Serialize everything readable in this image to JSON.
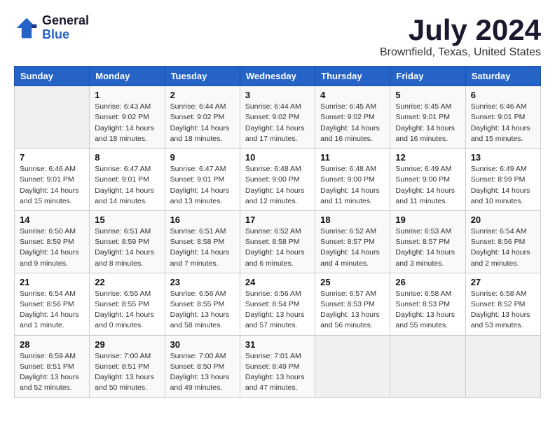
{
  "logo": {
    "general": "General",
    "blue": "Blue"
  },
  "title": "July 2024",
  "subtitle": "Brownfield, Texas, United States",
  "days_of_week": [
    "Sunday",
    "Monday",
    "Tuesday",
    "Wednesday",
    "Thursday",
    "Friday",
    "Saturday"
  ],
  "weeks": [
    [
      {
        "day": "",
        "info": ""
      },
      {
        "day": "1",
        "info": "Sunrise: 6:43 AM\nSunset: 9:02 PM\nDaylight: 14 hours\nand 18 minutes."
      },
      {
        "day": "2",
        "info": "Sunrise: 6:44 AM\nSunset: 9:02 PM\nDaylight: 14 hours\nand 18 minutes."
      },
      {
        "day": "3",
        "info": "Sunrise: 6:44 AM\nSunset: 9:02 PM\nDaylight: 14 hours\nand 17 minutes."
      },
      {
        "day": "4",
        "info": "Sunrise: 6:45 AM\nSunset: 9:02 PM\nDaylight: 14 hours\nand 16 minutes."
      },
      {
        "day": "5",
        "info": "Sunrise: 6:45 AM\nSunset: 9:01 PM\nDaylight: 14 hours\nand 16 minutes."
      },
      {
        "day": "6",
        "info": "Sunrise: 6:46 AM\nSunset: 9:01 PM\nDaylight: 14 hours\nand 15 minutes."
      }
    ],
    [
      {
        "day": "7",
        "info": "Sunrise: 6:46 AM\nSunset: 9:01 PM\nDaylight: 14 hours\nand 15 minutes."
      },
      {
        "day": "8",
        "info": "Sunrise: 6:47 AM\nSunset: 9:01 PM\nDaylight: 14 hours\nand 14 minutes."
      },
      {
        "day": "9",
        "info": "Sunrise: 6:47 AM\nSunset: 9:01 PM\nDaylight: 14 hours\nand 13 minutes."
      },
      {
        "day": "10",
        "info": "Sunrise: 6:48 AM\nSunset: 9:00 PM\nDaylight: 14 hours\nand 12 minutes."
      },
      {
        "day": "11",
        "info": "Sunrise: 6:48 AM\nSunset: 9:00 PM\nDaylight: 14 hours\nand 11 minutes."
      },
      {
        "day": "12",
        "info": "Sunrise: 6:49 AM\nSunset: 9:00 PM\nDaylight: 14 hours\nand 11 minutes."
      },
      {
        "day": "13",
        "info": "Sunrise: 6:49 AM\nSunset: 8:59 PM\nDaylight: 14 hours\nand 10 minutes."
      }
    ],
    [
      {
        "day": "14",
        "info": "Sunrise: 6:50 AM\nSunset: 8:59 PM\nDaylight: 14 hours\nand 9 minutes."
      },
      {
        "day": "15",
        "info": "Sunrise: 6:51 AM\nSunset: 8:59 PM\nDaylight: 14 hours\nand 8 minutes."
      },
      {
        "day": "16",
        "info": "Sunrise: 6:51 AM\nSunset: 8:58 PM\nDaylight: 14 hours\nand 7 minutes."
      },
      {
        "day": "17",
        "info": "Sunrise: 6:52 AM\nSunset: 8:58 PM\nDaylight: 14 hours\nand 6 minutes."
      },
      {
        "day": "18",
        "info": "Sunrise: 6:52 AM\nSunset: 8:57 PM\nDaylight: 14 hours\nand 4 minutes."
      },
      {
        "day": "19",
        "info": "Sunrise: 6:53 AM\nSunset: 8:57 PM\nDaylight: 14 hours\nand 3 minutes."
      },
      {
        "day": "20",
        "info": "Sunrise: 6:54 AM\nSunset: 8:56 PM\nDaylight: 14 hours\nand 2 minutes."
      }
    ],
    [
      {
        "day": "21",
        "info": "Sunrise: 6:54 AM\nSunset: 8:56 PM\nDaylight: 14 hours\nand 1 minute."
      },
      {
        "day": "22",
        "info": "Sunrise: 6:55 AM\nSunset: 8:55 PM\nDaylight: 14 hours\nand 0 minutes."
      },
      {
        "day": "23",
        "info": "Sunrise: 6:56 AM\nSunset: 8:55 PM\nDaylight: 13 hours\nand 58 minutes."
      },
      {
        "day": "24",
        "info": "Sunrise: 6:56 AM\nSunset: 8:54 PM\nDaylight: 13 hours\nand 57 minutes."
      },
      {
        "day": "25",
        "info": "Sunrise: 6:57 AM\nSunset: 8:53 PM\nDaylight: 13 hours\nand 56 minutes."
      },
      {
        "day": "26",
        "info": "Sunrise: 6:58 AM\nSunset: 8:53 PM\nDaylight: 13 hours\nand 55 minutes."
      },
      {
        "day": "27",
        "info": "Sunrise: 6:58 AM\nSunset: 8:52 PM\nDaylight: 13 hours\nand 53 minutes."
      }
    ],
    [
      {
        "day": "28",
        "info": "Sunrise: 6:59 AM\nSunset: 8:51 PM\nDaylight: 13 hours\nand 52 minutes."
      },
      {
        "day": "29",
        "info": "Sunrise: 7:00 AM\nSunset: 8:51 PM\nDaylight: 13 hours\nand 50 minutes."
      },
      {
        "day": "30",
        "info": "Sunrise: 7:00 AM\nSunset: 8:50 PM\nDaylight: 13 hours\nand 49 minutes."
      },
      {
        "day": "31",
        "info": "Sunrise: 7:01 AM\nSunset: 8:49 PM\nDaylight: 13 hours\nand 47 minutes."
      },
      {
        "day": "",
        "info": ""
      },
      {
        "day": "",
        "info": ""
      },
      {
        "day": "",
        "info": ""
      }
    ]
  ]
}
